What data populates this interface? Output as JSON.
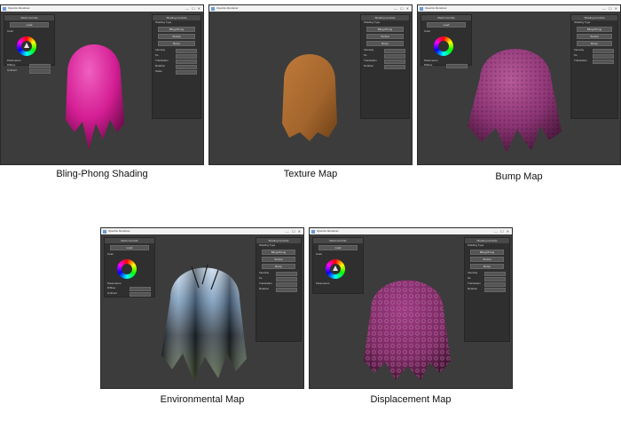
{
  "window": {
    "title": "OpenGL Renderer",
    "controls": "— ☐ ✕"
  },
  "panels": {
    "left_header": "Mesh Controls",
    "left_button": "Load",
    "color_label": "Color",
    "parameters_label": "Parameters",
    "param_rows": [
      "Diffuse",
      "Ambient"
    ],
    "right_header": "Shading Controls",
    "shading_type_label": "Shading Type",
    "shading_options": [
      "Bling-Phong",
      "Texture",
      "Bump"
    ],
    "right_rows": [
      "Intensity",
      "Ks",
      "Translation",
      "Rotation",
      "Scale"
    ]
  },
  "captions": {
    "p1": "Bling-Phong Shading",
    "p2": "Texture Map",
    "p3": "Bump Map",
    "p4": "Environmental Map",
    "p5": "Displacement Map"
  },
  "colors": {
    "bling_phong_cloth": "#d41e94",
    "texture_cloth": "#a2652c",
    "bump_cloth": "#8c3474",
    "environment_cloth": "#5a6e80",
    "displacement_cloth": "#7a2a62"
  }
}
